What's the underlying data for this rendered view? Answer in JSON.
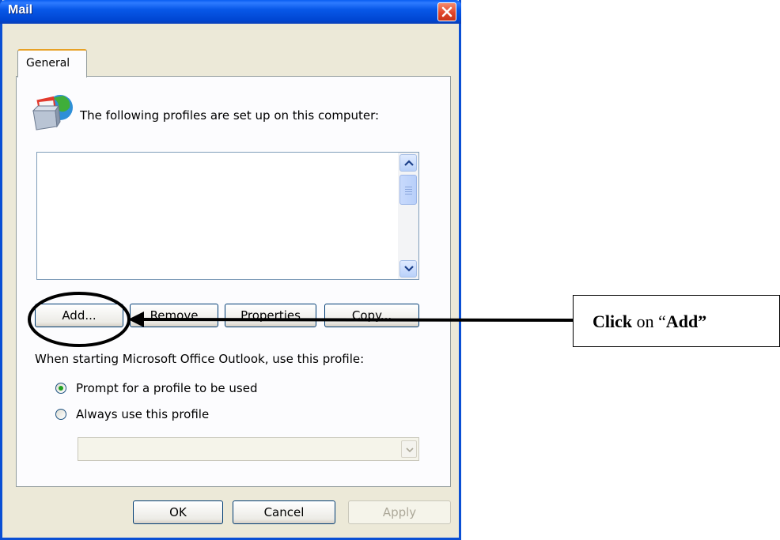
{
  "window": {
    "title": "Mail"
  },
  "tabs": [
    {
      "label": "General"
    }
  ],
  "general": {
    "profiles_label": "The following profiles are set up on this computer:",
    "profiles": [],
    "buttons": {
      "add": "Add...",
      "remove": "Remove",
      "properties": "Properties",
      "copy": "Copy..."
    },
    "startup_label": "When starting Microsoft Office Outlook, use this profile:",
    "radio_prompt": {
      "label": "Prompt for a profile to be used",
      "checked": true
    },
    "radio_always": {
      "label": "Always use this profile",
      "checked": false
    },
    "profile_dropdown": {
      "value": "",
      "enabled": false
    }
  },
  "footer": {
    "ok": "OK",
    "cancel": "Cancel",
    "apply": "Apply"
  },
  "annotation": {
    "bold1": "Click",
    "plain": " on “",
    "bold2": "Add”"
  },
  "colors": {
    "titlebar": "#0a5ef2",
    "accent_radio": "#21a121",
    "dialog_bg": "#ece9d8"
  },
  "icons": [
    "close-icon",
    "mail-profile-icon",
    "scroll-up-icon",
    "scroll-down-icon",
    "dropdown-arrow-icon"
  ]
}
